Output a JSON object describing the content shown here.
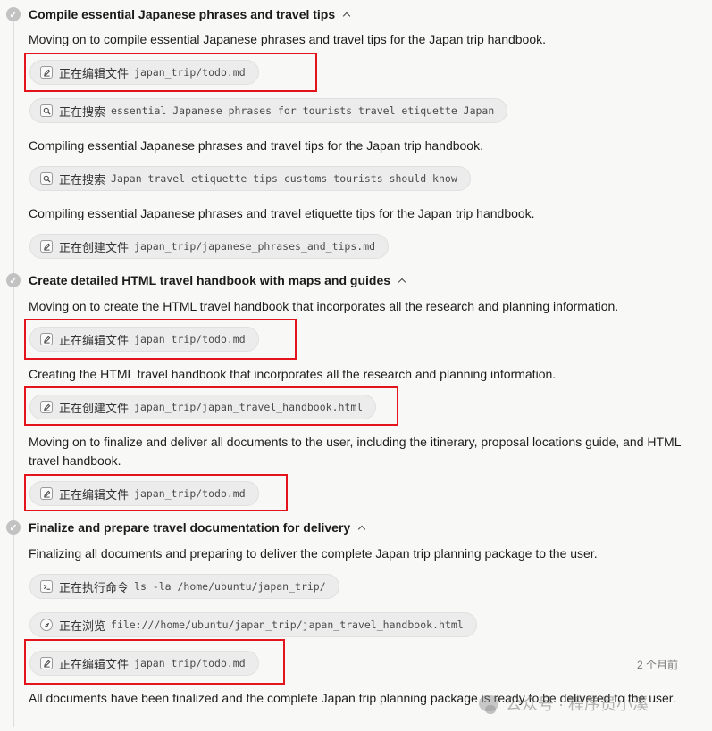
{
  "steps": [
    {
      "title": "Compile essential Japanese phrases and travel tips"
    },
    {
      "title": "Create detailed HTML travel handbook with maps and guides"
    },
    {
      "title": "Finalize and prepare travel documentation for delivery"
    }
  ],
  "messages": [
    "Moving on to compile essential Japanese phrases and travel tips for the Japan trip handbook.",
    "Compiling essential Japanese phrases and travel tips for the Japan trip handbook.",
    "Compiling essential Japanese phrases and travel etiquette tips for the Japan trip handbook.",
    "Moving on to create the HTML travel handbook that incorporates all the research and planning information.",
    "Creating the HTML travel handbook that incorporates all the research and planning information.",
    "Moving on to finalize and deliver all documents to the user, including the itinerary, proposal locations guide, and HTML travel handbook.",
    "Finalizing all documents and preparing to deliver the complete Japan trip planning package to the user.",
    "All documents have been finalized and the complete Japan trip planning package is ready to be delivered to the user."
  ],
  "actions": [
    {
      "icon": "edit-icon",
      "label": "正在编辑文件",
      "arg": "japan_trip/todo.md"
    },
    {
      "icon": "search-icon",
      "label": "正在搜索",
      "arg": "essential Japanese phrases for tourists travel etiquette Japan"
    },
    {
      "icon": "search-icon",
      "label": "正在搜索",
      "arg": "Japan travel etiquette tips customs tourists should know"
    },
    {
      "icon": "edit-icon",
      "label": "正在创建文件",
      "arg": "japan_trip/japanese_phrases_and_tips.md"
    },
    {
      "icon": "edit-icon",
      "label": "正在编辑文件",
      "arg": "japan_trip/todo.md"
    },
    {
      "icon": "edit-icon",
      "label": "正在创建文件",
      "arg": "japan_trip/japan_travel_handbook.html"
    },
    {
      "icon": "edit-icon",
      "label": "正在编辑文件",
      "arg": "japan_trip/todo.md"
    },
    {
      "icon": "terminal-icon",
      "label": "正在执行命令",
      "arg": "ls -la /home/ubuntu/japan_trip/"
    },
    {
      "icon": "browser-icon",
      "label": "正在浏览",
      "arg": "file:///home/ubuntu/japan_trip/japan_travel_handbook.html"
    },
    {
      "icon": "edit-icon",
      "label": "正在编辑文件",
      "arg": "japan_trip/todo.md"
    }
  ],
  "timestamp": "2 个月前",
  "watermark": "公众号 · 程序员小溪",
  "colors": {
    "highlight": "#e3141c",
    "pill_bg": "#ececec",
    "check": "#c2c2c2"
  }
}
